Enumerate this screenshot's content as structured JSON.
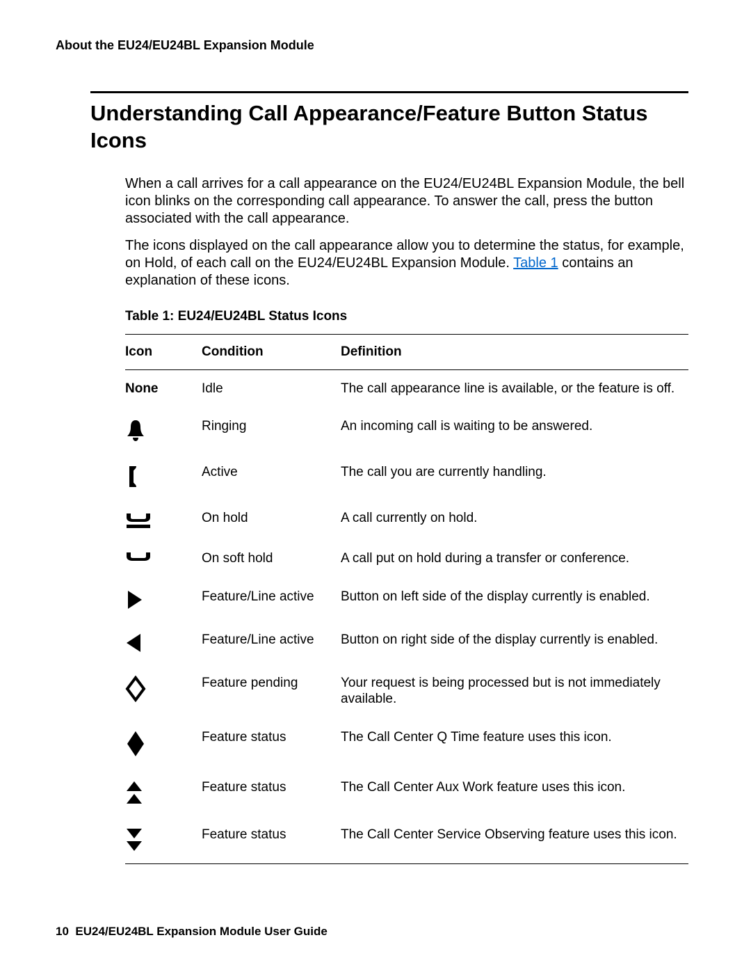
{
  "header": {
    "running_head": "About the EU24/EU24BL Expansion Module"
  },
  "title": "Understanding Call Appearance/Feature Button Status Icons",
  "paragraphs": {
    "p1": "When a call arrives for a call appearance on the EU24/EU24BL Expansion Module, the bell icon blinks on the corresponding call appearance. To answer the call, press the button associated with the call appearance.",
    "p2a": "The icons displayed on the call appearance allow you to determine the status, for example, on Hold, of each call on the EU24/EU24BL Expansion Module. ",
    "p2_link": "Table 1",
    "p2b": " contains an explanation of these icons."
  },
  "table": {
    "caption": "Table 1: EU24/EU24BL Status Icons",
    "headers": {
      "icon": "Icon",
      "condition": "Condition",
      "definition": "Definition"
    },
    "rows": [
      {
        "icon_text": "None",
        "icon_name": "none",
        "condition": "Idle",
        "definition": "The call appearance line is available, or the feature is off."
      },
      {
        "icon_text": "",
        "icon_name": "bell-icon",
        "condition": "Ringing",
        "definition": "An incoming call is waiting to be answered."
      },
      {
        "icon_text": "",
        "icon_name": "handset-icon",
        "condition": "Active",
        "definition": "The call you are currently handling."
      },
      {
        "icon_text": "",
        "icon_name": "hold-icon",
        "condition": "On hold",
        "definition": "A call currently on hold."
      },
      {
        "icon_text": "",
        "icon_name": "soft-hold-icon",
        "condition": "On soft hold",
        "definition": "A call put on hold during a transfer or conference."
      },
      {
        "icon_text": "",
        "icon_name": "triangle-right-icon",
        "condition": "Feature/Line active",
        "definition": "Button on left side of the display currently is enabled."
      },
      {
        "icon_text": "",
        "icon_name": "triangle-left-icon",
        "condition": "Feature/Line active",
        "definition": "Button on right side of the display currently is enabled."
      },
      {
        "icon_text": "",
        "icon_name": "diamond-outline-icon",
        "condition": "Feature pending",
        "definition": "Your request is being processed but is not immediately available."
      },
      {
        "icon_text": "",
        "icon_name": "diamond-filled-icon",
        "condition": "Feature status",
        "definition": "The Call Center Q Time feature uses this icon."
      },
      {
        "icon_text": "",
        "icon_name": "double-up-icon",
        "condition": "Feature status",
        "definition": "The Call Center Aux Work feature uses this icon."
      },
      {
        "icon_text": "",
        "icon_name": "double-down-icon",
        "condition": "Feature status",
        "definition": "The Call Center Service Observing feature uses this icon."
      }
    ]
  },
  "footer": {
    "page_number": "10",
    "guide_title": "EU24/EU24BL Expansion Module User Guide"
  }
}
